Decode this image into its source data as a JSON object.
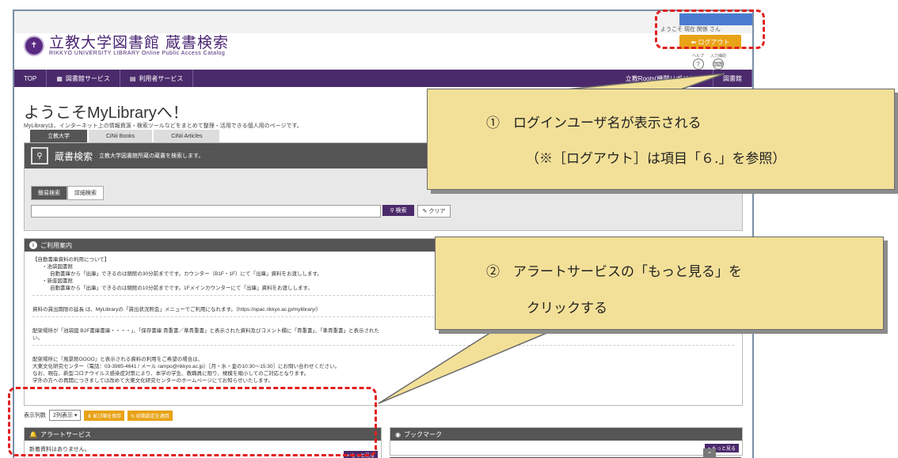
{
  "header": {
    "welcome_text": "ようこそ 現在 関係 さん",
    "logo_main": "立教大学図書館 蔵書検索",
    "logo_sub": "RIKKYO UNIVERSITY LIBRARY Online Public Access Catalog",
    "logout_label": "ログアウト",
    "help_label": "ヘルプ",
    "input_label": "入力補助"
  },
  "nav": {
    "items": [
      "TOP",
      "図書館サービス",
      "利用者サービス"
    ],
    "right_items": [
      "立教Roots(機関リポジトリ)",
      "図書館"
    ]
  },
  "page": {
    "title": "ようこそMyLibraryへ！",
    "description": "MyLibraryは、インターネット上の情報資源・検索ツールなどをまとめて整理・活用できる個人用のページです。"
  },
  "tabs": [
    "立教大学",
    "CiNii Books",
    "CiNii Articles"
  ],
  "search": {
    "heading": "蔵書検索",
    "subheading": "立教大学図書館所蔵の蔵書を検索します。",
    "simple_label": "簡易検索",
    "detail_label": "詳細検索",
    "search_button": "検索",
    "clear_button": "クリア",
    "query_value": ""
  },
  "info": {
    "heading": "ご利用案内",
    "lines": [
      "【自動書庫資料の利用について】",
      "・池袋図書館",
      "自動書庫から「出庫」できるのは閉館の30分前までです。カウンター（B1F・1F）にて「出庫」資料をお渡しします。",
      "・新座図書館",
      "自動書庫から「出庫」できるのは閉館の10分前までです。1Fメインカウンターにて「出庫」資料をお渡しします。",
      "資料の貸出期限の延長 は、MyLibraryの「貸出状況照会」メニューでご利用になれます。（https://opac.rikkyo.ac.jp/mylibrary/）",
      "配架場所が「池袋図 B2F書庫書庫・・・・」、「保存書庫 貴重書／準貴重書」と表示された資料及びコメント欄に「貴重書」、「準貴重書」と表示された",
      "い。",
      "配架場所に『風景館OOOO』と表示される資料の利用をご希望の場合は、",
      "大東文化研究センター（電話：03-3985-4641 / メール rampo@rikkyo.ac.jp）［月・水・金の10:30〜15:30］にお問い合わせください。",
      "なお、現在、新型コロナウイルス感染症対策により、本学の学生、教職員に限り、規模を縮小してのご対応となります。",
      "学外の方への再開につきましては改めて大東文化研究センターのホームページにてお知らせいたします。"
    ]
  },
  "layout_controls": {
    "label": "表示列数",
    "value": "2列表示",
    "save_button": "並び順を保存",
    "reset_button": "初期設定を適用"
  },
  "alert": {
    "heading": "アラートサービス",
    "empty_text": "新着資料はありません。",
    "more": "+ もっと見る"
  },
  "bookmark": {
    "heading": "ブックマーク",
    "more": "+ もっと見る"
  },
  "callouts": {
    "c1_line1": "①　ログインユーザ名が表示される",
    "c1_line2": "（※［ログアウト］は項目「６.」を参照）",
    "c2_line1": "②　アラートサービスの「もっと見る」を",
    "c2_line2": "クリックする"
  },
  "colors": {
    "brand_purple": "#4b2a6b",
    "logout_orange": "#e8a317",
    "callout_yellow": "#f3e098",
    "highlight_red": "#e02020"
  }
}
